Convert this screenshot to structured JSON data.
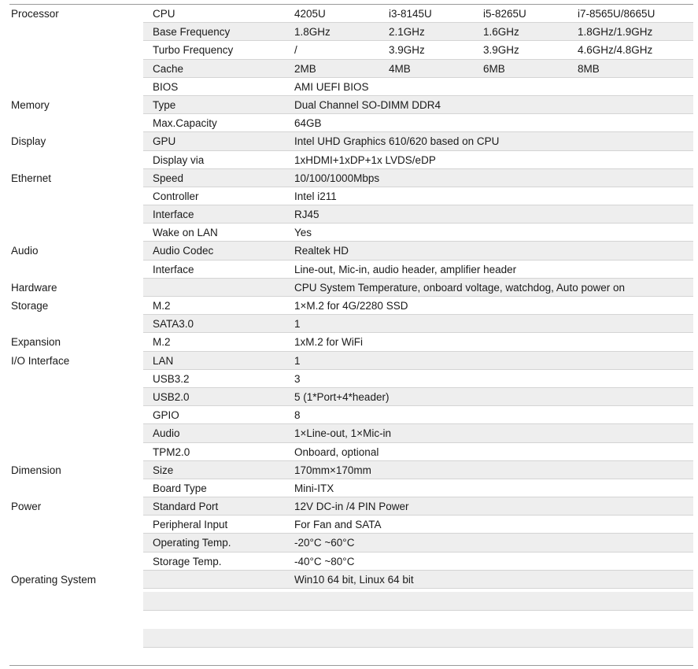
{
  "rows": [
    {
      "category": "Processor",
      "label": "CPU",
      "values": [
        "4205U",
        "i3-8145U",
        "i5-8265U",
        "i7-8565U/8665U"
      ]
    },
    {
      "category": "",
      "label": "Base Frequency",
      "values": [
        "1.8GHz",
        "2.1GHz",
        "1.6GHz",
        "1.8GHz/1.9GHz"
      ]
    },
    {
      "category": "",
      "label": "Turbo Frequency",
      "values": [
        "/",
        "3.9GHz",
        "3.9GHz",
        "4.6GHz/4.8GHz"
      ]
    },
    {
      "category": "",
      "label": "Cache",
      "values": [
        "2MB",
        "4MB",
        "6MB",
        "8MB"
      ]
    },
    {
      "category": "",
      "label": "BIOS",
      "values": [
        "AMI UEFI BIOS"
      ]
    },
    {
      "category": "Memory",
      "label": "Type",
      "values": [
        "Dual Channel SO-DIMM DDR4"
      ]
    },
    {
      "category": "",
      "label": "Max.Capacity",
      "values": [
        "64GB"
      ]
    },
    {
      "category": "Display",
      "label": "GPU",
      "values": [
        "Intel UHD Graphics 610/620 based on CPU"
      ]
    },
    {
      "category": "",
      "label": "Display via",
      "values": [
        "1xHDMI+1xDP+1x LVDS/eDP"
      ]
    },
    {
      "category": "Ethernet",
      "label": "Speed",
      "values": [
        "10/100/1000Mbps"
      ]
    },
    {
      "category": "",
      "label": "Controller",
      "values": [
        "Intel i211"
      ]
    },
    {
      "category": "",
      "label": "Interface",
      "values": [
        "RJ45"
      ]
    },
    {
      "category": "",
      "label": "Wake on LAN",
      "values": [
        "Yes"
      ]
    },
    {
      "category": "Audio",
      "label": "Audio Codec",
      "values": [
        "Realtek HD"
      ]
    },
    {
      "category": "",
      "label": "Interface",
      "values": [
        "Line-out, Mic-in, audio header, amplifier header"
      ]
    },
    {
      "category": "Hardware",
      "label": "",
      "values": [
        "CPU System Temperature, onboard voltage, watchdog, Auto power on"
      ]
    },
    {
      "category": "Storage",
      "label": "M.2",
      "values": [
        "1×M.2 for 4G/2280 SSD"
      ]
    },
    {
      "category": "",
      "label": "SATA3.0",
      "values": [
        "1"
      ]
    },
    {
      "category": "Expansion",
      "label": "M.2",
      "values": [
        "1xM.2 for WiFi"
      ]
    },
    {
      "category": "I/O Interface",
      "label": "LAN",
      "values": [
        "1"
      ]
    },
    {
      "category": "",
      "label": "USB3.2",
      "values": [
        "3"
      ]
    },
    {
      "category": "",
      "label": "USB2.0",
      "values": [
        "5 (1*Port+4*header)"
      ]
    },
    {
      "category": "",
      "label": "GPIO",
      "values": [
        "8"
      ]
    },
    {
      "category": "",
      "label": "Audio",
      "values": [
        "1×Line-out, 1×Mic-in"
      ]
    },
    {
      "category": "",
      "label": "TPM2.0",
      "values": [
        "Onboard, optional"
      ]
    },
    {
      "category": "Dimension",
      "label": "Size",
      "values": [
        "170mm×170mm"
      ]
    },
    {
      "category": "",
      "label": "Board Type",
      "values": [
        "Mini-ITX"
      ]
    },
    {
      "category": "Power",
      "label": "Standard Port",
      "values": [
        "12V DC-in /4 PIN Power"
      ]
    },
    {
      "category": "",
      "label": "Peripheral Input",
      "values": [
        "For Fan and SATA"
      ]
    },
    {
      "category": "",
      "label": "Operating Temp.",
      "values": [
        "-20°C ~60°C"
      ]
    },
    {
      "category": "",
      "label": "Storage Temp.",
      "values": [
        "-40°C ~80°C"
      ]
    },
    {
      "category": "Operating System",
      "label": "",
      "values": [
        "Win10 64 bit, Linux 64 bit"
      ]
    }
  ],
  "colors": {
    "shade": "#eeeeee",
    "rule": "#9a9a9a",
    "separator": "#d4d4d4",
    "text": "#1a1a1a"
  }
}
